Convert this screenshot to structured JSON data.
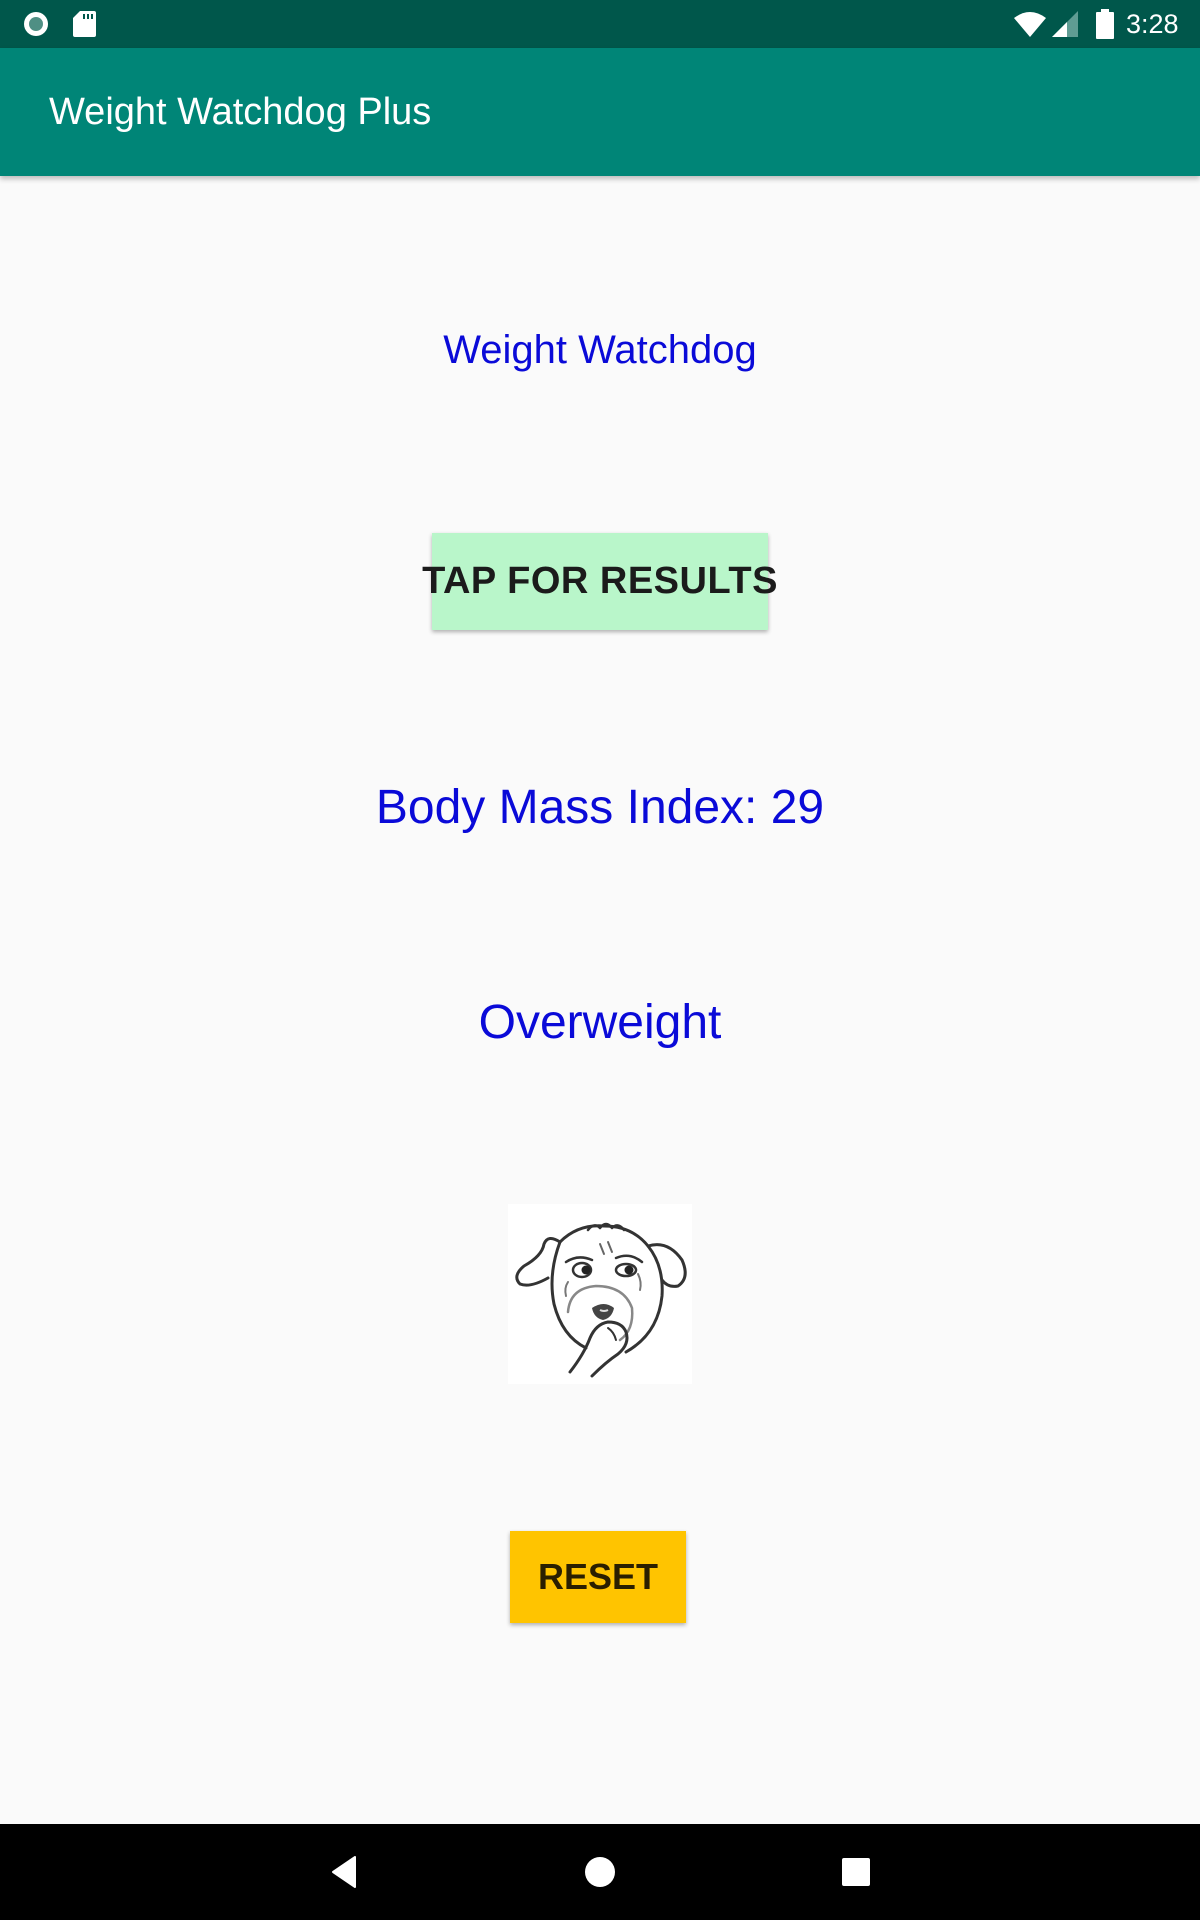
{
  "status_bar": {
    "time": "3:28",
    "left_icons": [
      "notification-circle-icon",
      "sd-card-icon"
    ],
    "right_icons": [
      "wifi-icon",
      "cell-signal-icon",
      "battery-icon"
    ]
  },
  "app_bar": {
    "title": "Weight Watchdog Plus"
  },
  "main": {
    "heading": "Weight Watchdog",
    "tap_button_label": "TAP FOR RESULTS",
    "bmi_label": "Body Mass Index: 29",
    "bmi_value": 29,
    "category": "Overweight",
    "image": "thinking-dog-icon",
    "reset_button_label": "RESET"
  },
  "colors": {
    "status_bar": "#00574b",
    "app_bar": "#008577",
    "text_blue": "#0a0ad8",
    "tap_button": "#b9f6ca",
    "reset_button": "#ffc400",
    "background": "#fafafa"
  },
  "nav_bar": {
    "buttons": [
      "back-icon",
      "home-icon",
      "recents-icon"
    ]
  }
}
